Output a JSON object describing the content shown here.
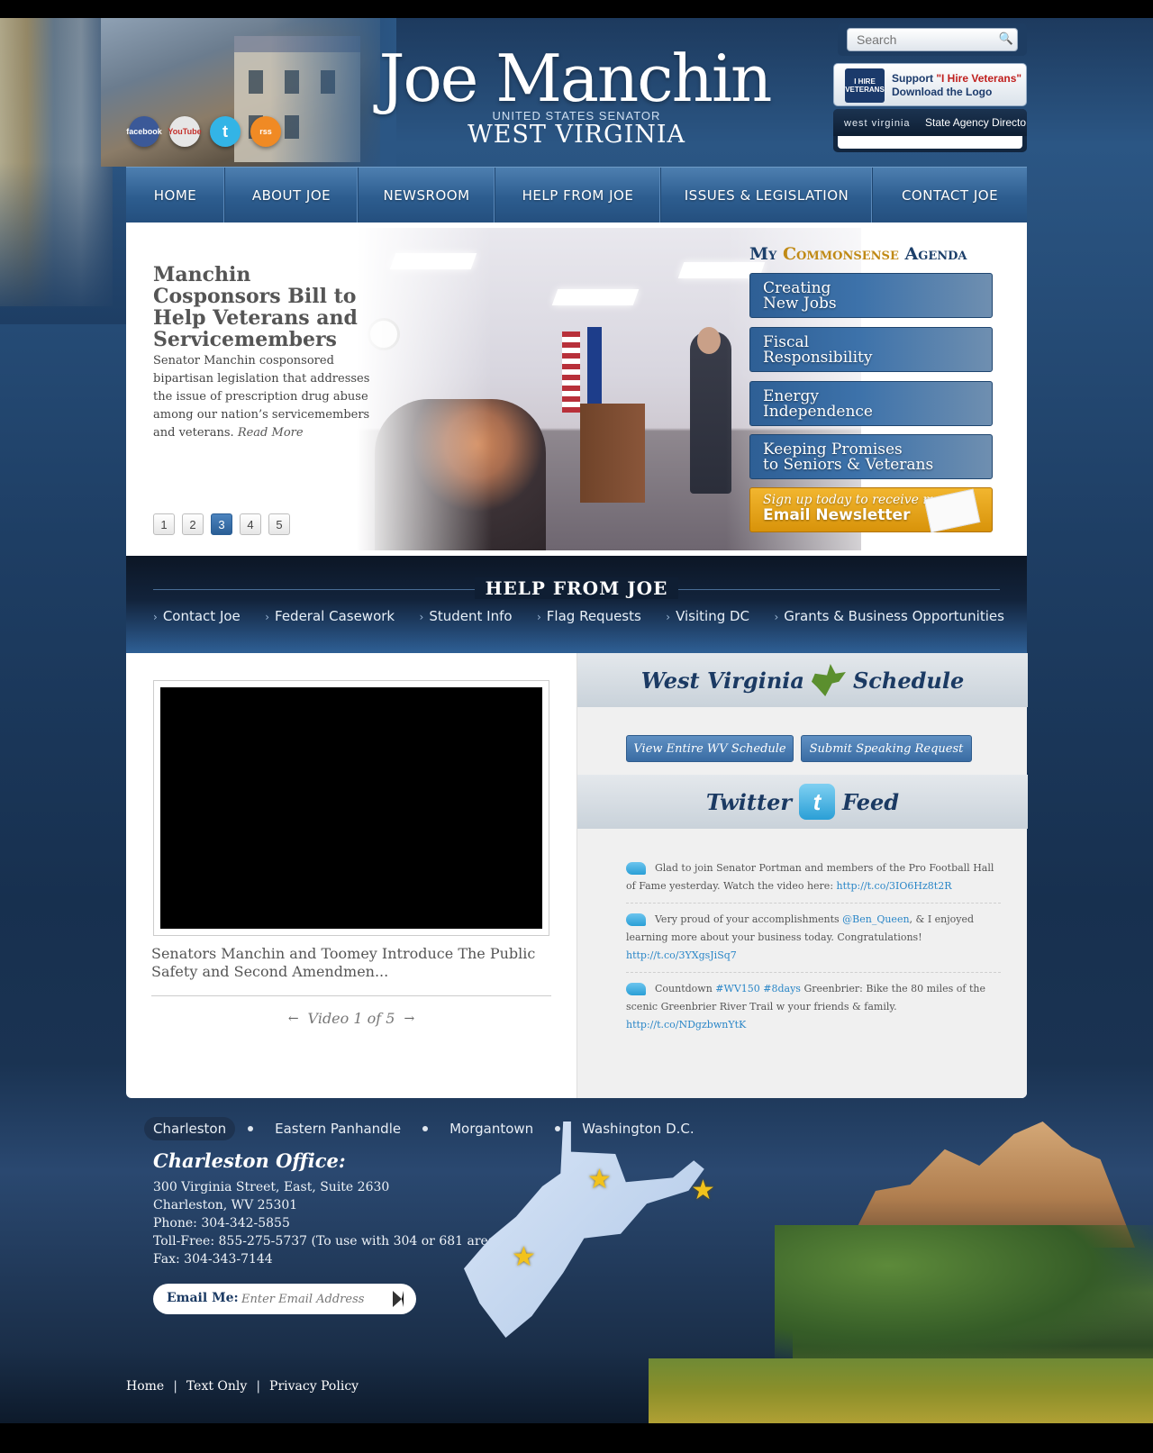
{
  "header": {
    "title": "Joe Manchin",
    "subtitle": "UNITED STATES SENATOR",
    "state": "WEST VIRGINIA",
    "social": [
      {
        "name": "facebook",
        "label": "facebook",
        "color": "#3b5998"
      },
      {
        "name": "youtube",
        "label": "YouTube",
        "color": "#e6e6e6"
      },
      {
        "name": "twitter",
        "label": "t",
        "color": "#33b4e6"
      },
      {
        "name": "rss",
        "label": "rss",
        "color": "#f08a24"
      }
    ],
    "search_placeholder": "Search",
    "veterans_logo": "I HIRE VETERANS",
    "veterans_line1_a": "Support ",
    "veterans_line1_b": "\"I Hire Veterans\"",
    "veterans_line2": "Download the Logo",
    "agency_brand": "west virginia",
    "agency_label": "State Agency Directo"
  },
  "nav": [
    "HOME",
    "ABOUT JOE",
    "NEWSROOM",
    "HELP FROM JOE",
    "ISSUES & LEGISLATION",
    "CONTACT JOE"
  ],
  "hero": {
    "title": "Manchin Cosponsors Bill to Help Veterans and Servicemembers",
    "body": "Senator Manchin cosponsored bipartisan legislation that addresses the issue of prescription drug abuse among our nation’s servicemembers and veterans.",
    "read_more": "Read More",
    "pages": [
      "1",
      "2",
      "3",
      "4",
      "5"
    ],
    "active_page": "3"
  },
  "agenda": {
    "title_a": "My ",
    "title_b": "Commonsense",
    "title_c": " Agenda",
    "items": [
      {
        "line1": "Creating",
        "line2": "New Jobs"
      },
      {
        "line1": "Fiscal",
        "line2": "Responsibility"
      },
      {
        "line1": "Energy",
        "line2": "Independence"
      },
      {
        "line1": "Keeping Promises",
        "line2": "to Seniors & Veterans"
      }
    ],
    "newsletter_line1": "Sign up today to receive my",
    "newsletter_line2": "Email Newsletter"
  },
  "help": {
    "title": "HELP FROM JOE",
    "links": [
      "Contact Joe",
      "Federal Casework",
      "Student Info",
      "Flag Requests",
      "Visiting DC",
      "Grants & Business Opportunities"
    ]
  },
  "video": {
    "title": "Senators Manchin and Toomey Introduce The Public Safety and Second Amendmen...",
    "counter": "Video 1 of 5",
    "prev": "←",
    "next": "→"
  },
  "schedule": {
    "title_a": "West Virginia",
    "title_b": "Schedule",
    "btn_view": "View Entire WV Schedule",
    "btn_submit": "Submit Speaking Request"
  },
  "twitter": {
    "title_a": "Twitter",
    "title_b": "Feed",
    "icon": "t",
    "tweets": [
      {
        "text": "Glad to join Senator Portman and members of the Pro Football Hall of Fame yesterday. Watch the video here: ",
        "link": "http://t.co/3IO6Hz8t2R"
      },
      {
        "text_a": "Very proud of your accomplishments ",
        "mention": "@Ben_Queen",
        "text_b": ", & I enjoyed learning more about your business today. Congratulations! ",
        "link": "http://t.co/3YXgsJiSq7"
      },
      {
        "text_a": "Countdown ",
        "tag1": "#WV150",
        "tag2": "#8days",
        "text_b": " Greenbrier: Bike the 80 miles of the scenic Greenbrier River Trail w your friends & family. ",
        "link": "http://t.co/NDgzbwnYtK"
      }
    ]
  },
  "footer": {
    "locations": [
      "Charleston",
      "Eastern Panhandle",
      "Morgantown",
      "Washington D.C."
    ],
    "active_location": "Charleston",
    "office_title": "Charleston Office:",
    "office_lines": [
      "300 Virginia Street, East, Suite 2630",
      "Charleston, WV 25301",
      "Phone: 304-342-5855",
      "Toll-Free: 855-275-5737 (To use with 304 or 681 area code)",
      "Fax: 304-343-7144"
    ],
    "email_label": "Email Me:",
    "email_placeholder": "Enter Email Address",
    "links": [
      "Home",
      "Text Only",
      "Privacy Policy"
    ],
    "link_separator": "|"
  },
  "colors": {
    "nav_blue": "#2d5d8f",
    "gold": "#c08a16",
    "newsletter_orange": "#e3a01c",
    "link_blue": "#2a86c7"
  }
}
